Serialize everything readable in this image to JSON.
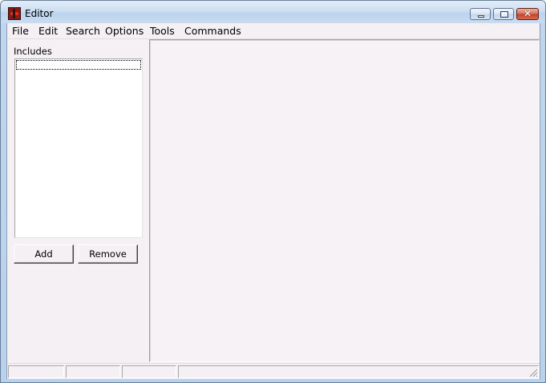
{
  "window": {
    "title": "Editor",
    "app_icon": "editor-app-icon",
    "controls": {
      "minimize": "minimize-icon",
      "maximize": "maximize-icon",
      "close": "close-icon",
      "close_glyph": "✕"
    }
  },
  "menu": {
    "items": [
      {
        "label": "File"
      },
      {
        "label": "Edit"
      },
      {
        "label": "Search"
      },
      {
        "label": "Options"
      },
      {
        "label": "Tools"
      },
      {
        "label": "Commands"
      }
    ]
  },
  "sidebar": {
    "includes_label": "Includes",
    "add_label": "Add",
    "remove_label": "Remove"
  },
  "statusbar": {
    "panes": [
      "",
      "",
      "",
      ""
    ],
    "grip": "resize-grip-icon"
  },
  "colors": {
    "client_bg": "#f4f0f4",
    "titlebar_bg": "#c8dbf1",
    "close_button": "#c4432b"
  }
}
